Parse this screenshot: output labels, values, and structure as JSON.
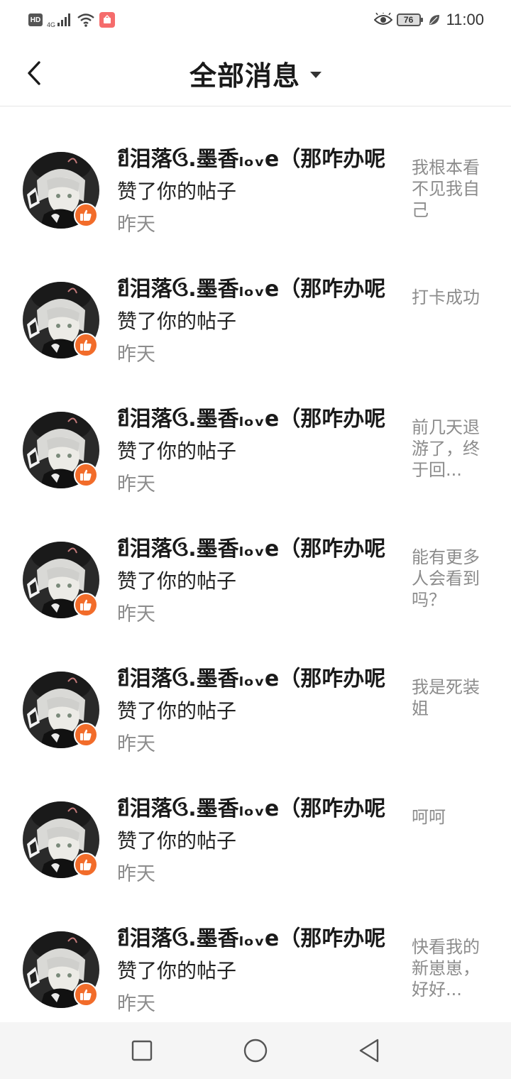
{
  "status_bar": {
    "hd_label": "HD",
    "network_type": "4G",
    "battery_level": "76",
    "time": "11:00",
    "icons": [
      "hd-icon",
      "signal-icon",
      "wifi-icon",
      "app-notification-icon",
      "eye-icon",
      "battery-icon",
      "leaf-icon"
    ]
  },
  "header": {
    "title": "全部消息",
    "back_icon": "chevron-left-icon",
    "dropdown_icon": "caret-down-icon"
  },
  "messages": [
    {
      "sender": "ยี泪落ઉ.墨香ₗₒᵥe（那咋办呢",
      "action": "赞了你的帖子",
      "time": "昨天",
      "post": "我根本看不见我自己"
    },
    {
      "sender": "ยี泪落ઉ.墨香ₗₒᵥe（那咋办呢",
      "action": "赞了你的帖子",
      "time": "昨天",
      "post": "打卡成功"
    },
    {
      "sender": "ยี泪落ઉ.墨香ₗₒᵥe（那咋办呢",
      "action": "赞了你的帖子",
      "time": "昨天",
      "post": "前几天退游了，终于回..."
    },
    {
      "sender": "ยี泪落ઉ.墨香ₗₒᵥe（那咋办呢",
      "action": "赞了你的帖子",
      "time": "昨天",
      "post": "能有更多人会看到吗？"
    },
    {
      "sender": "ยี泪落ઉ.墨香ₗₒᵥe（那咋办呢",
      "action": "赞了你的帖子",
      "time": "昨天",
      "post": "我是死装姐"
    },
    {
      "sender": "ยี泪落ઉ.墨香ₗₒᵥe（那咋办呢",
      "action": "赞了你的帖子",
      "time": "昨天",
      "post": "呵呵"
    },
    {
      "sender": "ยี泪落ઉ.墨香ₗₒᵥe（那咋办呢",
      "action": "赞了你的帖子",
      "time": "昨天",
      "post": "快看我的新崽崽，好好..."
    }
  ],
  "nav_bar": {
    "icons": [
      "recent-apps-icon",
      "home-icon",
      "back-triangle-icon"
    ]
  },
  "colors": {
    "like_badge": "#f26c2a",
    "secondary_text": "#8c8c8c",
    "primary_text": "#1a1a1a"
  }
}
